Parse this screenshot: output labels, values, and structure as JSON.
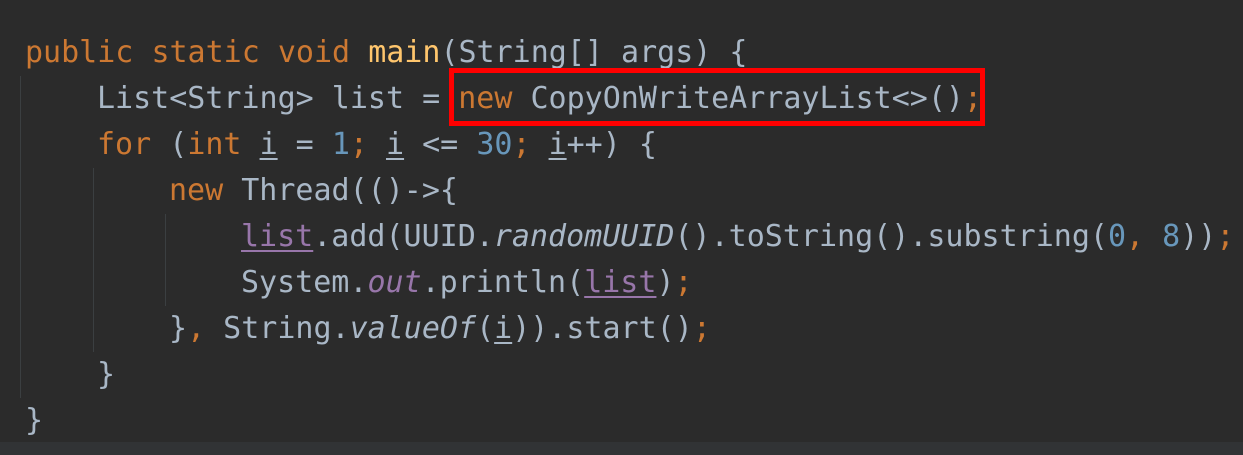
{
  "editor": {
    "lines": {
      "l1": {
        "kw_public": "public",
        "kw_static": "static",
        "kw_void": "void",
        "method": "main",
        "rest": "(String[] args) {"
      },
      "l2": {
        "decl": "List<String> list = ",
        "kw_new": "new",
        "ctor": " CopyOnWriteArrayList<>()",
        "semi": ";"
      },
      "l3": {
        "kw_for": "for",
        "open": " (",
        "kw_int": "int",
        "sp1": " ",
        "var_i1": "i",
        "eq": " = ",
        "num_1": "1",
        "semi1": ";",
        "sp2": " ",
        "var_i2": "i",
        "le": " <= ",
        "num_30": "30",
        "semi2": ";",
        "sp3": " ",
        "var_i3": "i",
        "close": "++) {"
      },
      "l4": {
        "kw_new": "new",
        "rest": " Thread(()->{"
      },
      "l5": {
        "list": "list",
        "mid": ".add(UUID.",
        "random": "randomUUID",
        "mid2": "().toString().substring(",
        "num_0": "0",
        "comma": ",",
        "sp": " ",
        "num_8": "8",
        "close": "))",
        "semi": ";"
      },
      "l6": {
        "sys": "System.",
        "out": "out",
        "println": ".println(",
        "list": "list",
        "close": ")",
        "semi": ";"
      },
      "l7": {
        "brace": "}",
        "comma": ",",
        "str": " String.",
        "valueOf": "valueOf",
        "open": "(",
        "var_i": "i",
        "close": ")).start()",
        "semi": ";"
      },
      "l8": {
        "brace": "}"
      },
      "l9": {
        "brace": "}"
      }
    },
    "colors": {
      "background": "#2b2b2b",
      "keyword": "#cc7832",
      "method": "#ffc66d",
      "number": "#6897bb",
      "field": "#9876aa",
      "text": "#a9b7c6",
      "highlight": "#ff0000"
    }
  }
}
